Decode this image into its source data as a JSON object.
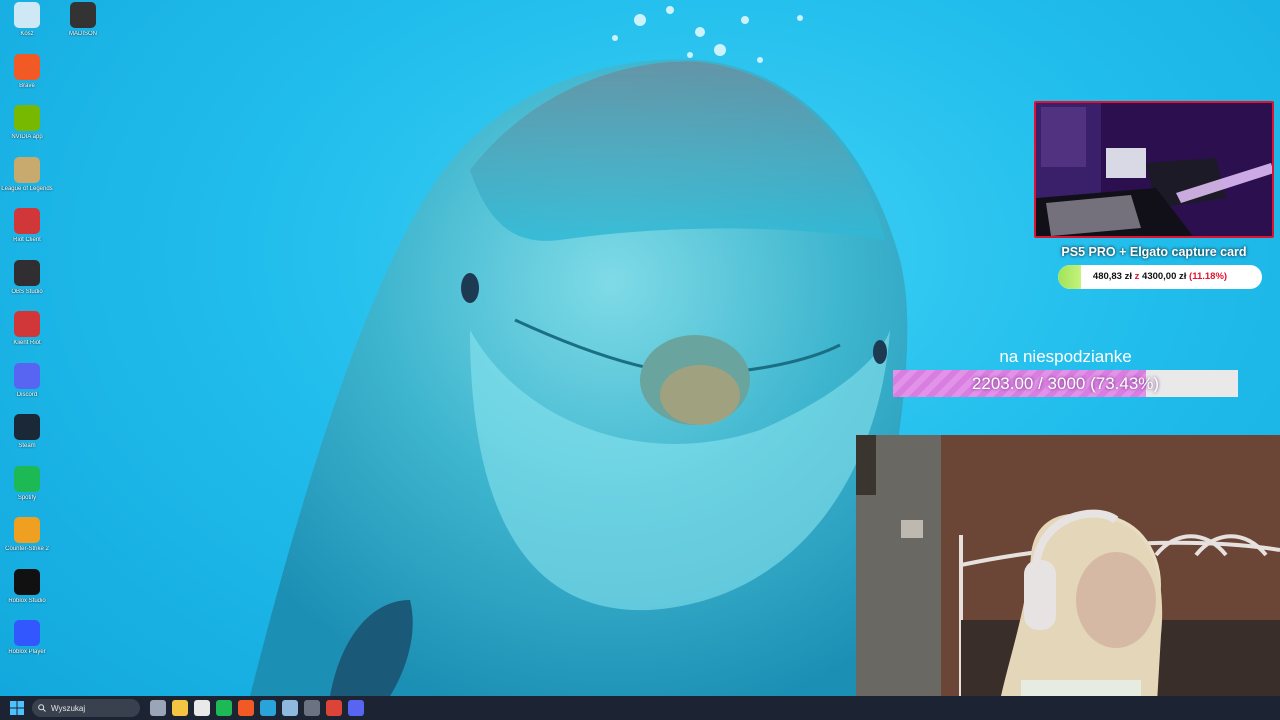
{
  "desktop_icons": [
    {
      "label": "Kosz",
      "icon": "recycle-bin-icon",
      "color": "#cfe8f5"
    },
    {
      "label": "Brave",
      "icon": "brave-icon",
      "color": "#f15a24"
    },
    {
      "label": "NVIDIA app",
      "icon": "nvidia-icon",
      "color": "#76b900"
    },
    {
      "label": "League of Legends",
      "icon": "league-icon",
      "color": "#c8aa6e"
    },
    {
      "label": "Riot Client",
      "icon": "riot-icon",
      "color": "#d13639"
    },
    {
      "label": "OBS Studio",
      "icon": "obs-icon",
      "color": "#302e31"
    },
    {
      "label": "Klient Riot",
      "icon": "riot-icon",
      "color": "#d13639"
    },
    {
      "label": "Discord",
      "icon": "discord-icon",
      "color": "#5865f2"
    },
    {
      "label": "Steam",
      "icon": "steam-icon",
      "color": "#1b2838"
    },
    {
      "label": "Spotify",
      "icon": "spotify-icon",
      "color": "#1db954"
    },
    {
      "label": "Counter-Strike 2",
      "icon": "cs2-icon",
      "color": "#f0a020"
    },
    {
      "label": "Roblox Studio",
      "icon": "roblox-studio-icon",
      "color": "#111111"
    },
    {
      "label": "Roblox Player",
      "icon": "roblox-icon",
      "color": "#3357ff"
    }
  ],
  "desktop_icons_col2": [
    {
      "label": "MADISON",
      "icon": "game-shortcut-icon",
      "color": "#333333"
    }
  ],
  "goal": {
    "title": "PS5 PRO + Elgato capture card",
    "raised": "480,83 zł",
    "separator": "z",
    "target": "4300,00 zł",
    "percent_text": "(11.18%)",
    "progress": 0.1118
  },
  "surprise": {
    "title": "na niespodzianke",
    "text": "2203.00 / 3000 (73.43%)",
    "progress": 0.7343
  },
  "taskbar": {
    "search_placeholder": "Wyszukaj",
    "apps": [
      {
        "icon": "task-view-icon",
        "color": "#9aa6b8"
      },
      {
        "icon": "file-explorer-icon",
        "color": "#f4c542"
      },
      {
        "icon": "calendar-icon",
        "color": "#e9e9e9"
      },
      {
        "icon": "spotify-icon",
        "color": "#1db954"
      },
      {
        "icon": "brave-icon",
        "color": "#f15a24"
      },
      {
        "icon": "edge-icon",
        "color": "#2aa3d8"
      },
      {
        "icon": "notepad-icon",
        "color": "#8fb8de"
      },
      {
        "icon": "calculator-icon",
        "color": "#6b7382"
      },
      {
        "icon": "chrome-icon",
        "color": "#db4437"
      },
      {
        "icon": "discord-icon",
        "color": "#5865f2"
      }
    ]
  }
}
